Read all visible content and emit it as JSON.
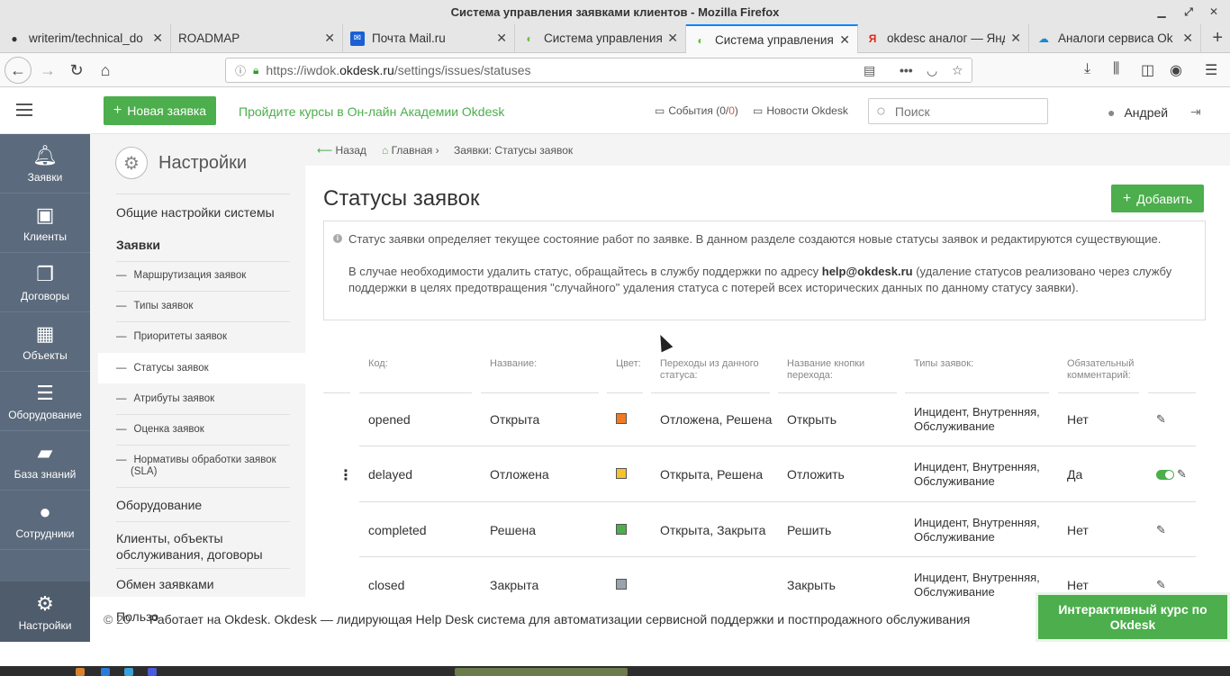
{
  "window": {
    "title": "Система управления заявками клиентов - Mozilla Firefox"
  },
  "tabs": [
    {
      "label": "writerim/technical_do",
      "icon": "github-icon"
    },
    {
      "label": "ROADMAP",
      "icon": ""
    },
    {
      "label": "Почта Mail.ru",
      "icon": "mail-icon"
    },
    {
      "label": "Система управления",
      "icon": "okdesk-icon"
    },
    {
      "label": "Система управления",
      "icon": "okdesk-icon",
      "active": true
    },
    {
      "label": "okdesc аналог — Янд",
      "icon": "yandex-icon"
    },
    {
      "label": "Аналоги сервиса Ok",
      "icon": "cloud-icon"
    }
  ],
  "url": {
    "prefix": "https://iwdok.",
    "domain": "okdesk.ru",
    "path": "/settings/issues/statuses"
  },
  "header": {
    "new_issue": "Новая заявка",
    "courses_link": "Пройдите курсы в Он-лайн Академии Okdesk",
    "events_label": "События",
    "events_count_open": " (0/",
    "events_count_red": "0",
    "events_count_close": ")",
    "news_label": "Новости Okdesk",
    "search_placeholder": "Поиск",
    "user_name": "Андрей"
  },
  "leftnav": [
    {
      "label": "Заявки",
      "icon": "bell-icon"
    },
    {
      "label": "Клиенты",
      "icon": "briefcase-icon"
    },
    {
      "label": "Договоры",
      "icon": "documents-icon"
    },
    {
      "label": "Объекты",
      "icon": "building-icon"
    },
    {
      "label": "Оборудование",
      "icon": "server-icon"
    },
    {
      "label": "База знаний",
      "icon": "book-icon"
    },
    {
      "label": "Сотрудники",
      "icon": "user-icon"
    }
  ],
  "leftnav_settings": "Настройки",
  "settings_menu": {
    "title": "Настройки",
    "general": "Общие настройки системы",
    "issues": "Заявки",
    "sub": [
      "Маршрутизация заявок",
      "Типы заявок",
      "Приоритеты заявок",
      "Статусы заявок",
      "Атрибуты заявок",
      "Оценка заявок",
      "Нормативы обработки заявок (SLA)"
    ],
    "equipment": "Оборудование",
    "clients": "Клиенты, объекты обслуживания, договоры",
    "exchange": "Обмен заявками",
    "partial": "Пользо"
  },
  "breadcrumb": {
    "back": "Назад",
    "home": "Главная",
    "current": "Заявки: Статусы заявок"
  },
  "main": {
    "title": "Статусы заявок",
    "add_button": "Добавить",
    "info_p1": "Статус заявки определяет текущее состояние работ по заявке. В данном разделе создаются новые статусы заявок и редактируются существующие.",
    "info_p2a": "В случае необходимости удалить статус, обращайтесь в службу поддержки по адресу ",
    "info_email": "help@okdesk.ru",
    "info_p2b": " (удаление статусов реализовано через службу поддержки в целях предотвращения \"случайного\" удаления статуса с потерей всех исторических данных по данному статусу заявки)."
  },
  "table": {
    "headers": {
      "code": "Код:",
      "name": "Название:",
      "color": "Цвет:",
      "transitions": "Переходы из данного статуса:",
      "button": "Название кнопки перехода:",
      "types": "Типы заявок:",
      "comment": "Обязательный комментарий:"
    },
    "rows": [
      {
        "code": "opened",
        "name": "Открыта",
        "color": "#f07b22",
        "transitions": "Отложена, Решена",
        "button": "Открыть",
        "types": "Инцидент, Внутренняя, Обслуживание",
        "comment": "Нет"
      },
      {
        "code": "delayed",
        "name": "Отложена",
        "color": "#f6c22d",
        "transitions": "Открыта, Решена",
        "button": "Отложить",
        "types": "Инцидент, Внутренняя, Обслуживание",
        "comment": "Да"
      },
      {
        "code": "completed",
        "name": "Решена",
        "color": "#4cae4c",
        "transitions": "Открыта, Закрыта",
        "button": "Решить",
        "types": "Инцидент, Внутренняя, Обслуживание",
        "comment": "Нет"
      },
      {
        "code": "closed",
        "name": "Закрыта",
        "color": "#9aa3ad",
        "transitions": "",
        "button": "Закрыть",
        "types": "Инцидент, Внутренняя, Обслуживание",
        "comment": "Нет"
      }
    ]
  },
  "footer": {
    "copyright": "© 20",
    "text": "Работает на Okdesk. Okdesk — лидирующая Help Desk система для автоматизации сервисной поддержки и постпродажного обслуживания",
    "course_button": "Интерактивный курс по Okdesk"
  },
  "colors": {
    "brand_green": "#4cae4c",
    "sidebar": "#5b6a7c"
  }
}
